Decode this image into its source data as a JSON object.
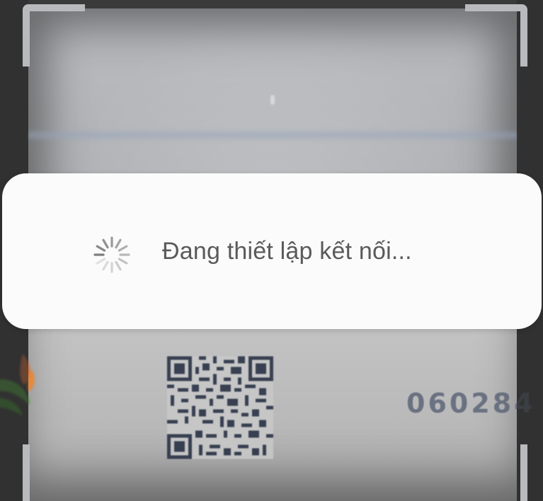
{
  "dialog": {
    "message": "Đang thiết lập kết nối..."
  },
  "background_card": {
    "number": "060284"
  },
  "icons": {
    "spinner": "loading-spinner-icon",
    "qr": "qr-code",
    "logo": "partial-logo"
  },
  "colors": {
    "dialog_bg": "#fbfbfb",
    "text": "#5a5a5a",
    "viewfinder": "#b9babd",
    "card_number": "#5d6577"
  }
}
